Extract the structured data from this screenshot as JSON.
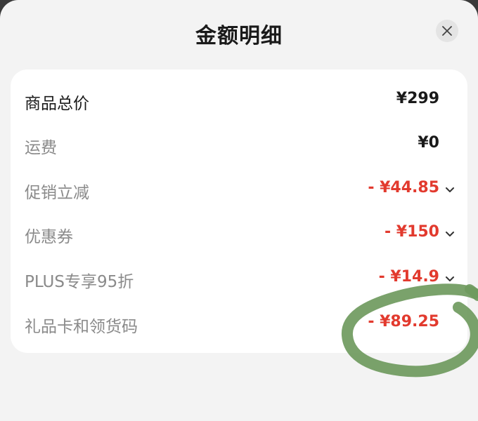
{
  "header": {
    "title": "金额明细",
    "close_icon": "close-icon"
  },
  "rows": [
    {
      "label": "商品总价",
      "value": "¥299",
      "style": "normal",
      "expandable": false
    },
    {
      "label": "运费",
      "value": "¥0",
      "style": "normal",
      "expandable": false
    },
    {
      "label": "促销立减",
      "value": "- ¥44.85",
      "style": "discount",
      "expandable": true
    },
    {
      "label": "优惠券",
      "value": "- ¥150",
      "style": "discount",
      "expandable": true
    },
    {
      "label": "PLUS专享95折",
      "value": "- ¥14.9",
      "style": "discount",
      "expandable": true
    },
    {
      "label": "礼品卡和领货码",
      "value": "- ¥89.25",
      "style": "discount",
      "expandable": false
    }
  ],
  "colors": {
    "discount": "#e23a2e",
    "annotation": "#6f9a5e",
    "sheet_bg": "#f3f3f3",
    "card_bg": "#ffffff"
  }
}
